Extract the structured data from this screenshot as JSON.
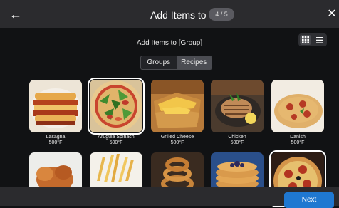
{
  "header": {
    "title": "Add Items to",
    "step": "4 / 5"
  },
  "subtitle": "Add Items to [Group]",
  "segment": {
    "tabs": [
      {
        "label": "Groups",
        "active": false
      },
      {
        "label": "Recipes",
        "active": true
      }
    ]
  },
  "recipes": [
    {
      "name": "Lasagna",
      "temp": "500°F",
      "selected": false
    },
    {
      "name": "Arugula Spinach",
      "temp": "500°F",
      "selected": true
    },
    {
      "name": "Grilled Cheese",
      "temp": "500°F",
      "selected": false
    },
    {
      "name": "Chicken",
      "temp": "500°F",
      "selected": false
    },
    {
      "name": "Danish",
      "temp": "500°F",
      "selected": false
    }
  ],
  "footer": {
    "next_label": "Next"
  },
  "colors": {
    "accent": "#1f78d1",
    "header_bg": "#2b2b2e",
    "page_bg": "#111214"
  }
}
